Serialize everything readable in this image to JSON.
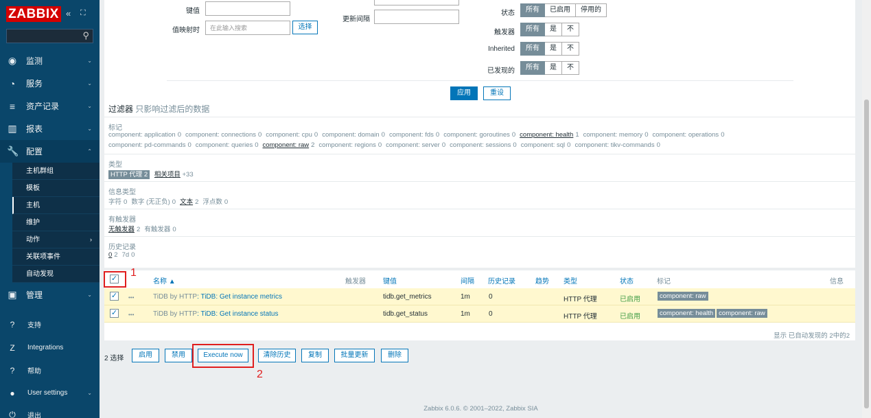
{
  "sidebar": {
    "logo": "ZABBIX",
    "collapse_icon": "«",
    "kiosk_icon": "⛶",
    "search_icon": "⚲",
    "menu": [
      {
        "icon": "◉",
        "label": "监测"
      },
      {
        "icon": "◔",
        "label": "服务"
      },
      {
        "icon": "≡",
        "label": "资产记录"
      },
      {
        "icon": "▥",
        "label": "报表"
      },
      {
        "icon": "🔧",
        "label": "配置"
      }
    ],
    "submenu": [
      {
        "label": "主机群组"
      },
      {
        "label": "模板"
      },
      {
        "label": "主机"
      },
      {
        "label": "维护"
      },
      {
        "label": "动作",
        "chevron": "›"
      },
      {
        "label": "关联项事件"
      },
      {
        "label": "自动发现"
      }
    ],
    "admin": {
      "icon": "▣",
      "label": "管理"
    },
    "bottom": [
      {
        "icon": "?",
        "label": "支持"
      },
      {
        "icon": "Z",
        "label": "Integrations"
      },
      {
        "icon": "?",
        "label": "帮助"
      },
      {
        "icon": "●",
        "label": "User settings"
      },
      {
        "icon": "⏻",
        "label": "退出"
      }
    ]
  },
  "filter": {
    "key_label": "键值",
    "value_mapping_label": "值映射时",
    "value_mapping_placeholder": "在此输入搜索",
    "select_button": "选择",
    "update_interval_label": "更新间隔",
    "status_label": "状态",
    "status_options": [
      "所有",
      "已启用",
      "停用的"
    ],
    "triggers_label": "触发器",
    "inherited_label": "Inherited",
    "discovered_label": "已发现的",
    "yn_options": [
      "所有",
      "是",
      "不"
    ],
    "apply_button": "应用",
    "reset_button": "重设"
  },
  "subfilter": {
    "title": "过滤器",
    "subtitle": "只影响过滤后的数据",
    "tags_title": "标记",
    "tags_line1": [
      {
        "t": "component: application",
        "c": "0"
      },
      {
        "t": "component: connections",
        "c": "0"
      },
      {
        "t": "component: cpu",
        "c": "0"
      },
      {
        "t": "component: domain",
        "c": "0"
      },
      {
        "t": "component: fds",
        "c": "0"
      },
      {
        "t": "component: goroutines",
        "c": "0"
      },
      {
        "t": "component: health",
        "c": "1",
        "u": true
      },
      {
        "t": "component: memory",
        "c": "0"
      },
      {
        "t": "component: operations",
        "c": "0"
      }
    ],
    "tags_line2": [
      {
        "t": "component: pd-commands",
        "c": "0"
      },
      {
        "t": "component: queries",
        "c": "0"
      },
      {
        "t": "component: raw",
        "c": "2",
        "u": true
      },
      {
        "t": "component: regions",
        "c": "0"
      },
      {
        "t": "component: server",
        "c": "0"
      },
      {
        "t": "component: sessions",
        "c": "0"
      },
      {
        "t": "component: sql",
        "c": "0"
      },
      {
        "t": "component: tikv-commands",
        "c": "0"
      }
    ],
    "type_title": "类型",
    "type_selected": "HTTP 代理 2",
    "type_related": "相关项目",
    "type_more": "+33",
    "info_type_title": "信息类型",
    "info_types": [
      {
        "t": "字符",
        "c": "0"
      },
      {
        "t": "数字 (无正负)",
        "c": "0"
      },
      {
        "t": "文本",
        "c": "2",
        "u": true
      },
      {
        "t": "浮点数",
        "c": "0"
      }
    ],
    "has_triggers_title": "有触发器",
    "has_triggers": [
      {
        "t": "无触发器",
        "c": "2",
        "u": true
      },
      {
        "t": "有触发器",
        "c": "0"
      }
    ],
    "history_title": "历史记录",
    "history": [
      {
        "t": "0",
        "c": "2",
        "u": true
      },
      {
        "t": "7d",
        "c": "0"
      }
    ]
  },
  "table": {
    "headers": {
      "name": "名称 ▲",
      "triggers": "触发器",
      "key": "键值",
      "interval": "间隔",
      "history": "历史记录",
      "trends": "趋势",
      "type": "类型",
      "status": "状态",
      "tags": "标记",
      "info": "信息"
    },
    "rows": [
      {
        "dots": "•••",
        "template": "TiDB by HTTP",
        "sep": ": ",
        "name": "TiDB: Get instance metrics",
        "key": "tidb.get_metrics",
        "interval": "1m",
        "history": "0",
        "type": "HTTP 代理",
        "status": "已启用",
        "tags": [
          "component: raw"
        ]
      },
      {
        "dots": "•••",
        "template": "TiDB by HTTP",
        "sep": ": ",
        "name": "TiDB: Get instance status",
        "key": "tidb.get_status",
        "interval": "1m",
        "history": "0",
        "type": "HTTP 代理",
        "status": "已启用",
        "tags": [
          "component: health",
          "component: raw"
        ]
      }
    ],
    "footer": "显示 已自动发现的 2中的2"
  },
  "actions": {
    "selected": "2 选择",
    "buttons": [
      "启用",
      "禁用",
      "Execute now",
      "清除历史",
      "复制",
      "批量更新",
      "删除"
    ]
  },
  "annotations": {
    "one": "1",
    "two": "2"
  },
  "footer": "Zabbix 6.0.6. © 2001–2022, Zabbix SIA"
}
